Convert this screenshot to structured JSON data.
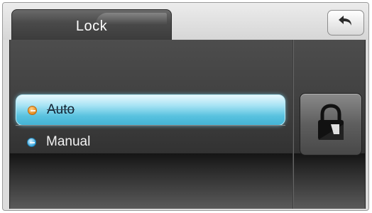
{
  "header": {
    "tab_label": "Lock",
    "back_icon": "back-arrow-icon"
  },
  "options": [
    {
      "label": "Auto",
      "selected": true,
      "icon": "orange-dot-icon",
      "color": "#e58a1c"
    },
    {
      "label": "Manual",
      "selected": false,
      "icon": "blue-dot-icon",
      "color": "#3aa6de"
    }
  ],
  "side": {
    "lock_icon": "padlock-icon"
  },
  "colors": {
    "accent": "#59c2df",
    "panel": "#3f3f3f"
  }
}
